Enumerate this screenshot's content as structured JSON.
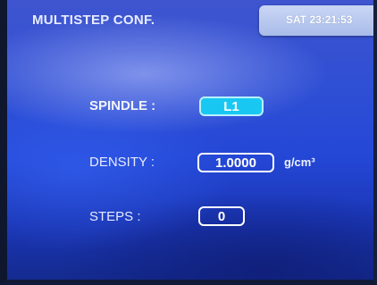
{
  "header": {
    "title": "MULTISTEP CONF.",
    "clock": "SAT 23:21:53"
  },
  "form": {
    "spindle": {
      "label": "SPINDLE :",
      "value": "L1"
    },
    "density": {
      "label": "DENSITY :",
      "value": "1.0000",
      "unit": "g/cm³"
    },
    "steps": {
      "label": "STEPS :",
      "value": "0"
    }
  },
  "colors": {
    "background": "#2447d6",
    "selected_field": "#19c8f2",
    "clock_box": "#b9c9ef"
  }
}
